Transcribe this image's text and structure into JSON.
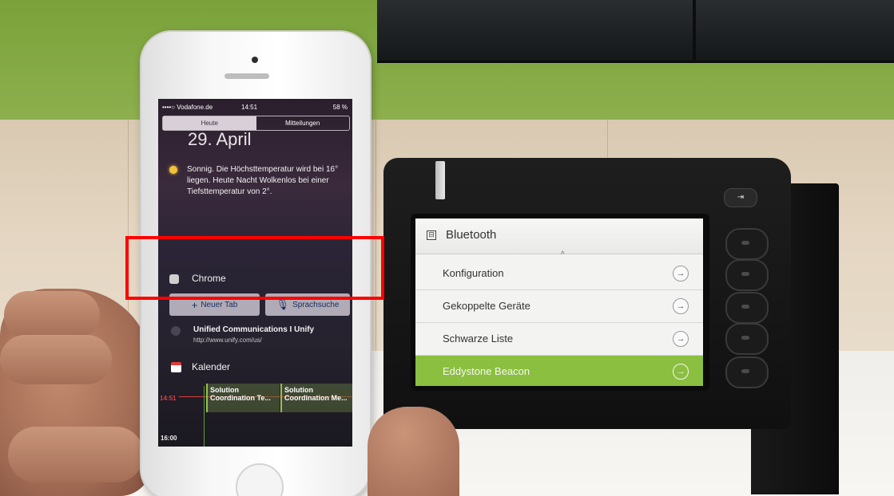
{
  "phone": {
    "status": {
      "carrier": "••••○ Vodafone.de",
      "time": "14:51",
      "battery": "58 %"
    },
    "tabs": [
      {
        "label": "Heute",
        "active": true
      },
      {
        "label": "Mitteilungen",
        "active": false
      }
    ],
    "date": "29. April",
    "weather": "Sonnig. Die Höchsttemperatur wird bei 16° liegen. Heute Nacht Wolkenlos bei einer Tiefsttemperatur von 2°.",
    "chrome": {
      "title": "Chrome",
      "new_tab": "Neuer Tab",
      "voice_search": "Sprachsuche",
      "plus_icon": "+",
      "mic_icon": "🎙"
    },
    "unify": {
      "title": "Unified Communications I Unify",
      "url": "http://www.unify.com/us/"
    },
    "calendar": {
      "title": "Kalender",
      "now": "14:51",
      "next_hour": "16:00",
      "events": [
        {
          "line1": "Solution",
          "line2": "Coordination Te..."
        },
        {
          "line1": "Solution",
          "line2": "Coordination Me..."
        }
      ]
    }
  },
  "desk_phone": {
    "exit_icon": "⇥",
    "header_icon": "⊟",
    "caret": "^",
    "title": "Bluetooth",
    "menu": [
      {
        "label": "Konfiguration",
        "selected": false
      },
      {
        "label": "Gekoppelte Geräte",
        "selected": false
      },
      {
        "label": "Schwarze Liste",
        "selected": false
      },
      {
        "label": "Eddystone Beacon",
        "selected": true
      }
    ],
    "arrow_icon": "→"
  },
  "colors": {
    "highlight": "#ff0000",
    "selected_row": "#8bbf3f",
    "wall_green": "#86ab47"
  }
}
